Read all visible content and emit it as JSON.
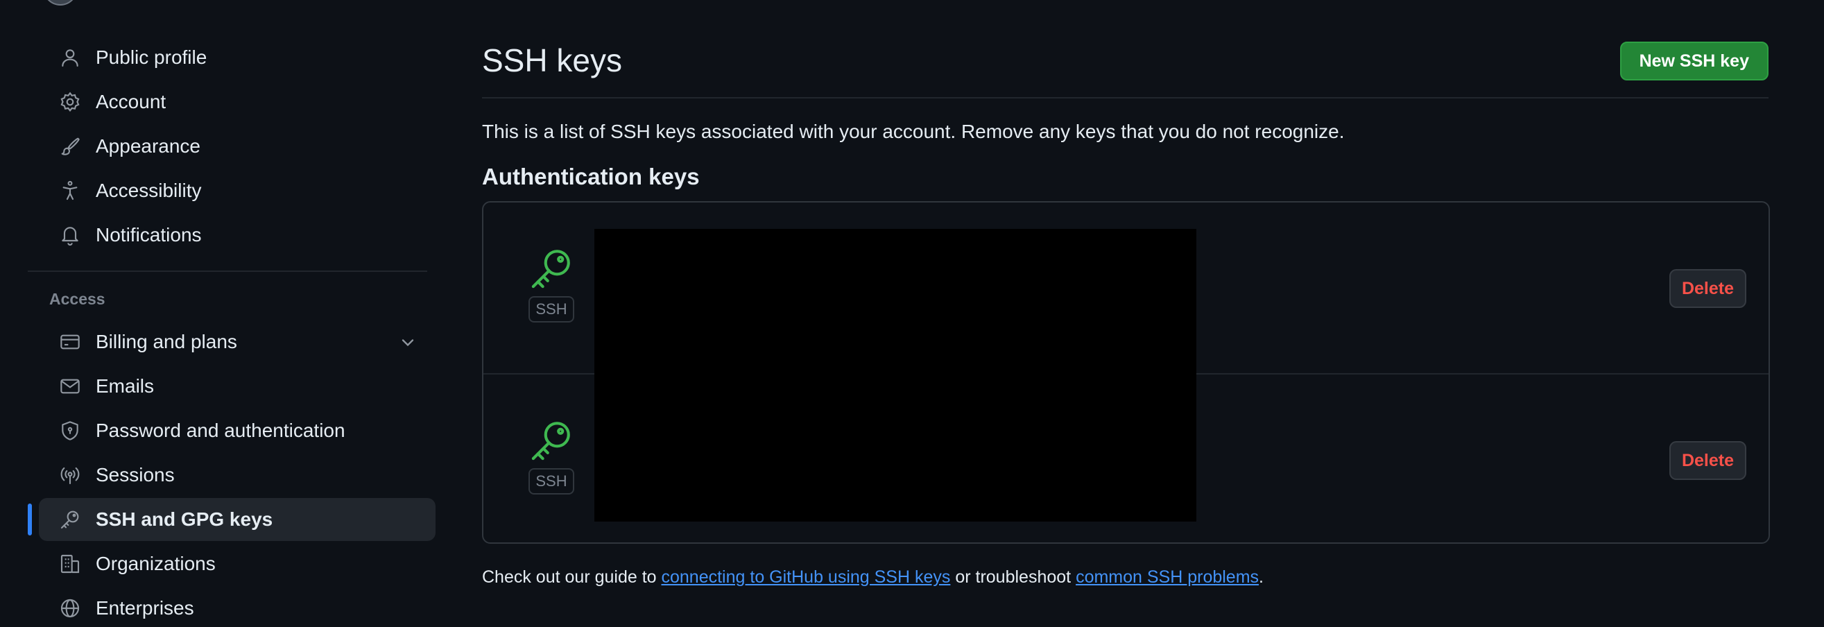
{
  "sidebar": {
    "items_top": [
      {
        "label": "Public profile",
        "icon": "person-icon"
      },
      {
        "label": "Account",
        "icon": "gear-icon"
      },
      {
        "label": "Appearance",
        "icon": "paintbrush-icon"
      },
      {
        "label": "Accessibility",
        "icon": "accessibility-icon"
      },
      {
        "label": "Notifications",
        "icon": "bell-icon"
      }
    ],
    "access_label": "Access",
    "items_access": [
      {
        "label": "Billing and plans",
        "icon": "credit-card-icon"
      },
      {
        "label": "Emails",
        "icon": "mail-icon"
      },
      {
        "label": "Password and authentication",
        "icon": "shield-lock-icon"
      },
      {
        "label": "Sessions",
        "icon": "broadcast-icon"
      },
      {
        "label": "SSH and GPG keys",
        "icon": "key-icon"
      },
      {
        "label": "Organizations",
        "icon": "organization-icon"
      },
      {
        "label": "Enterprises",
        "icon": "globe-icon"
      }
    ],
    "active_item": "SSH and GPG keys"
  },
  "main": {
    "title": "SSH keys",
    "new_key_button": "New SSH key",
    "intro": "This is a list of SSH keys associated with your account. Remove any keys that you do not recognize.",
    "auth_heading": "Authentication keys",
    "keys": [
      {
        "badge": "SSH",
        "delete_label": "Delete"
      },
      {
        "badge": "SSH",
        "delete_label": "Delete"
      }
    ],
    "guide": {
      "prefix": "Check out our guide to ",
      "link1": "connecting to GitHub using SSH keys",
      "middle": " or troubleshoot ",
      "link2": "common SSH problems",
      "suffix": "."
    }
  },
  "colors": {
    "background": "#0d1117",
    "accent_blue": "#2f81f7",
    "primary_green": "#238636",
    "danger_red": "#f85149",
    "key_icon_green": "#3fb950"
  }
}
